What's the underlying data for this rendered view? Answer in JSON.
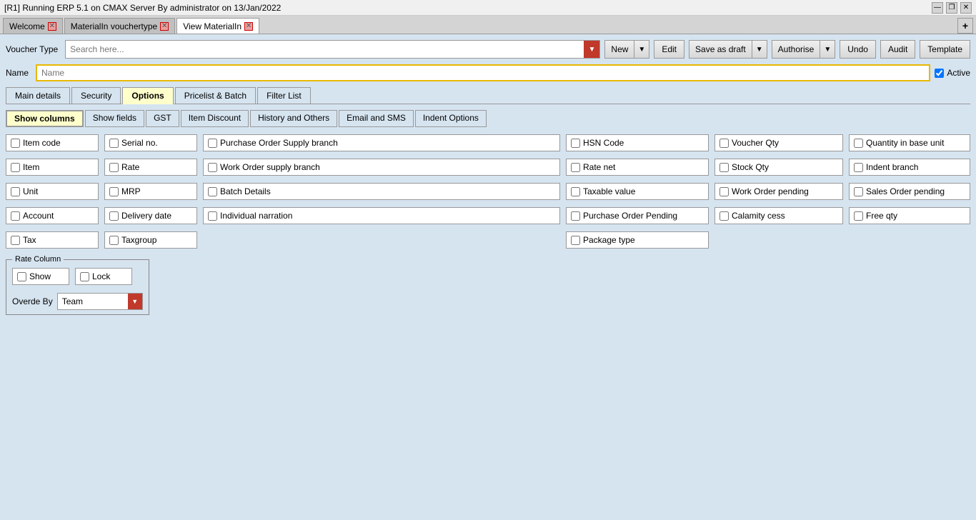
{
  "titleBar": {
    "text": "[R1] Running ERP 5.1 on CMAX Server By administrator on 13/Jan/2022",
    "minimize": "—",
    "restore": "❐",
    "close": "✕"
  },
  "tabs": [
    {
      "label": "Welcome",
      "closable": true,
      "active": false
    },
    {
      "label": "MaterialIn vouchertype",
      "closable": true,
      "active": false
    },
    {
      "label": "View MaterialIn",
      "closable": true,
      "active": true
    }
  ],
  "toolbar": {
    "voucherTypeLabel": "Voucher Type",
    "searchPlaceholder": "Search here...",
    "newLabel": "New",
    "editLabel": "Edit",
    "saveAsDraftLabel": "Save as draft",
    "authoriseLabel": "Authorise",
    "undoLabel": "Undo",
    "auditLabel": "Audit",
    "templateLabel": "Template"
  },
  "nameRow": {
    "label": "Name",
    "placeholder": "Name",
    "activeLabel": "Active",
    "activeChecked": true
  },
  "sectionTabs": [
    {
      "label": "Main details",
      "active": false
    },
    {
      "label": "Security",
      "active": false
    },
    {
      "label": "Options",
      "active": true
    },
    {
      "label": "Pricelist & Batch",
      "active": false
    },
    {
      "label": "Filter List",
      "active": false
    }
  ],
  "subTabs": [
    {
      "label": "Show columns",
      "active": true
    },
    {
      "label": "Show fields",
      "active": false
    },
    {
      "label": "GST",
      "active": false
    },
    {
      "label": "Item Discount",
      "active": false
    },
    {
      "label": "History and Others",
      "active": false
    },
    {
      "label": "Email and SMS",
      "active": false
    },
    {
      "label": "Indent Options",
      "active": false
    }
  ],
  "col1Checkboxes": [
    {
      "label": "Item code",
      "checked": false
    },
    {
      "label": "Item",
      "checked": false
    },
    {
      "label": "Unit",
      "checked": false
    },
    {
      "label": "Account",
      "checked": false
    },
    {
      "label": "Tax",
      "checked": false
    }
  ],
  "col2Checkboxes": [
    {
      "label": "Serial no.",
      "checked": false
    },
    {
      "label": "Rate",
      "checked": false
    },
    {
      "label": "MRP",
      "checked": false
    },
    {
      "label": "Delivery date",
      "checked": false
    },
    {
      "label": "Taxgroup",
      "checked": false
    }
  ],
  "col3Checkboxes": [
    {
      "label": "Purchase Order Supply branch",
      "checked": false
    },
    {
      "label": "Work Order supply branch",
      "checked": false
    },
    {
      "label": "Batch Details",
      "checked": false
    },
    {
      "label": "Individual narration",
      "checked": false
    }
  ],
  "col4Checkboxes": [
    {
      "label": "HSN  Code",
      "checked": false
    },
    {
      "label": "Rate net",
      "checked": false
    },
    {
      "label": "Taxable value",
      "checked": false
    },
    {
      "label": "Purchase Order Pending",
      "checked": false
    },
    {
      "label": "Package type",
      "checked": false
    }
  ],
  "col5Checkboxes": [
    {
      "label": "Voucher Qty",
      "checked": false
    },
    {
      "label": "Stock Qty",
      "checked": false
    },
    {
      "label": "Work Order pending",
      "checked": false
    },
    {
      "label": "Calamity cess",
      "checked": false
    }
  ],
  "col6Checkboxes": [
    {
      "label": "Quantity in base unit",
      "checked": false
    },
    {
      "label": "Indent branch",
      "checked": false
    },
    {
      "label": "Sales Order pending",
      "checked": false
    },
    {
      "label": "Free qty",
      "checked": false
    }
  ],
  "rateColumn": {
    "groupLabel": "Rate Column",
    "showLabel": "Show",
    "lockLabel": "Lock",
    "overrideByLabel": "Overde By",
    "overrideValue": "Team"
  }
}
